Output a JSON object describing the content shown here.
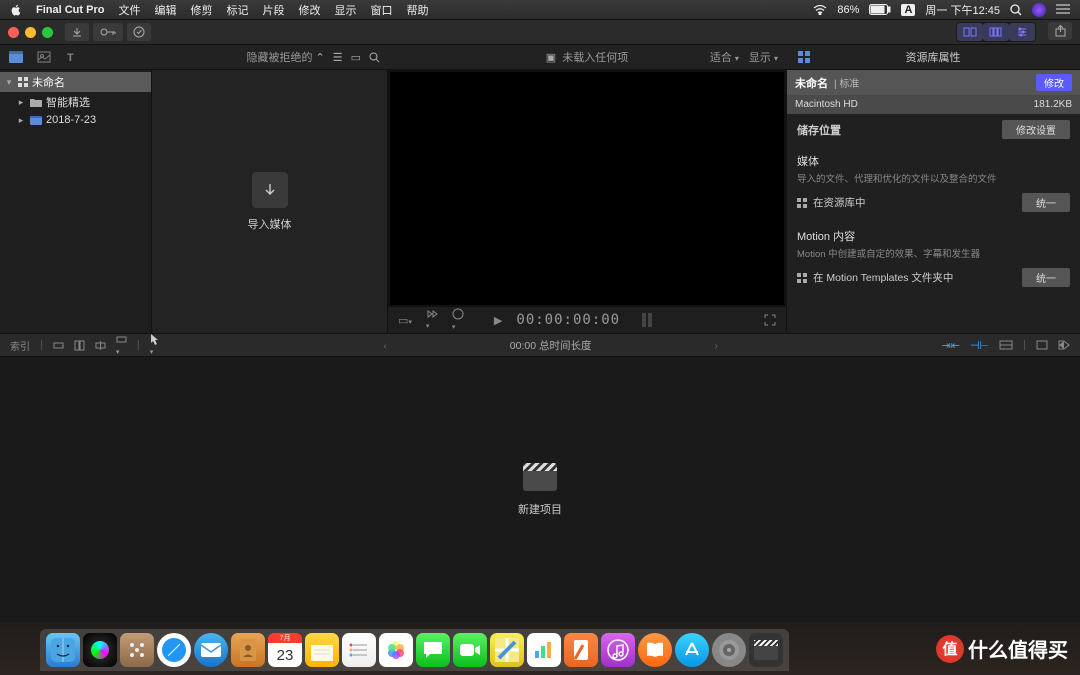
{
  "menubar": {
    "app": "Final Cut Pro",
    "items": [
      "文件",
      "编辑",
      "修剪",
      "标记",
      "片段",
      "修改",
      "显示",
      "窗口",
      "帮助"
    ],
    "battery_pct": "86%",
    "input": "A",
    "clock": "周一 下午12:45"
  },
  "browser_header": {
    "filter": "隐藏被拒绝的"
  },
  "viewer_header": {
    "status": "未载入任何项",
    "fit": "适合",
    "display": "显示"
  },
  "inspector_header": {
    "title": "资源库属性"
  },
  "sidebar": {
    "root": "未命名",
    "items": [
      "智能精选",
      "2018-7-23"
    ]
  },
  "browser": {
    "import_label": "导入媒体"
  },
  "viewer_controls": {
    "timecode": "00:00:00:00"
  },
  "inspector": {
    "name": "未命名",
    "std": "标准",
    "modify": "修改",
    "disk": "Macintosh HD",
    "disk_size": "181.2KB",
    "storage_title": "储存位置",
    "storage_btn": "修改设置",
    "media_title": "媒体",
    "media_desc": "导入的文件、代理和优化的文件以及整合的文件",
    "media_loc": "在资源库中",
    "unify": "统一",
    "motion_title": "Motion 内容",
    "motion_desc": "Motion 中创建或自定的效果、字幕和发生器",
    "motion_loc": "在 Motion Templates 文件夹中"
  },
  "tl_toolbar": {
    "index": "索引",
    "duration": "00:00 总时间长度"
  },
  "timeline": {
    "new_project": "新建项目"
  },
  "dock": {
    "cal_day": "23",
    "cal_month": "7月"
  },
  "watermark": {
    "char": "值",
    "text": "什么值得买"
  }
}
